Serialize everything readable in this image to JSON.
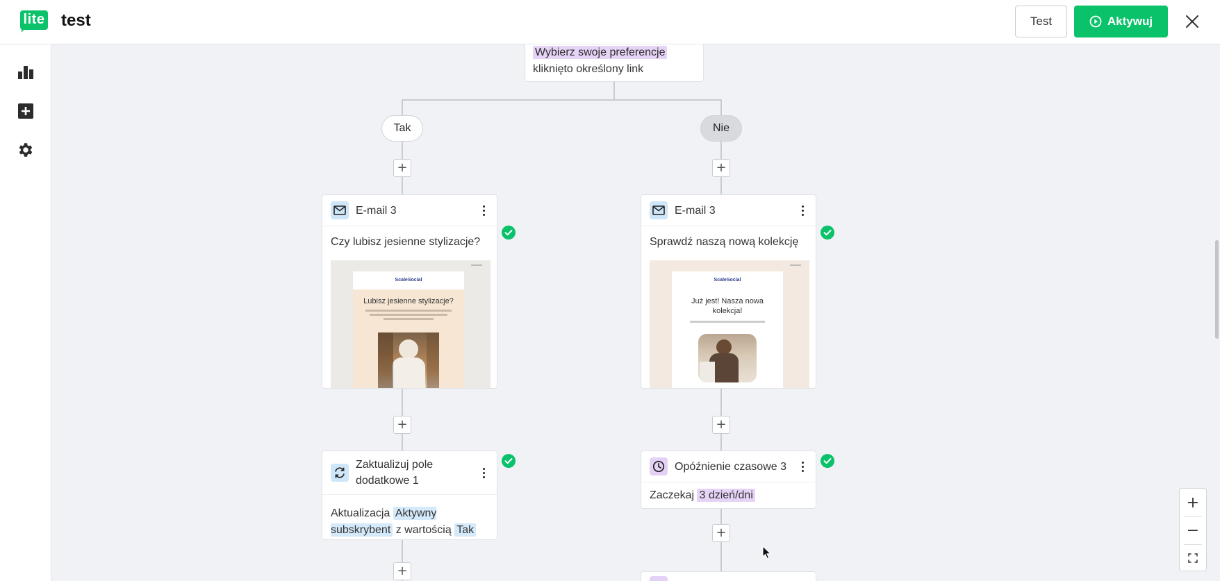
{
  "app": {
    "logo_text": "lite",
    "title": "test",
    "test_button": "Test",
    "activate_button": "Aktywuj"
  },
  "colors": {
    "brand_green": "#09c269",
    "highlight_purple": "#e6d4f7",
    "highlight_blue": "#d4e9f9"
  },
  "sidebar": {
    "items": [
      {
        "icon": "bar-chart-icon"
      },
      {
        "icon": "add-square-icon"
      },
      {
        "icon": "gear-icon"
      }
    ]
  },
  "condition_card": {
    "highlight": "Wybierz swoje preferencje",
    "text": "kliknięto określony link"
  },
  "branches": {
    "yes_label": "Tak",
    "no_label": "Nie"
  },
  "left_email": {
    "title": "E-mail 3",
    "subject": "Czy lubisz jesienne stylizacje?",
    "preview_brand": "ScaleSocial",
    "preview_headline": "Lubisz jesienne stylizacje?"
  },
  "right_email": {
    "title": "E-mail 3",
    "subject": "Sprawdź naszą nową kolekcję",
    "preview_brand": "ScaleSocial",
    "preview_headline": "Już jest! Nasza nowa kolekcja!"
  },
  "update_field": {
    "title": "Zaktualizuj pole dodatkowe 1",
    "prefix": "Aktualizacja",
    "field_name": "Aktywny subskrybent",
    "middle": "z wartością",
    "value": "Tak"
  },
  "delay": {
    "title": "Opóźnienie czasowe 3",
    "prefix": "Zaczekaj",
    "duration": "3 dzień/dni"
  },
  "zoom": {
    "zoom_in": "+",
    "zoom_out": "−"
  }
}
